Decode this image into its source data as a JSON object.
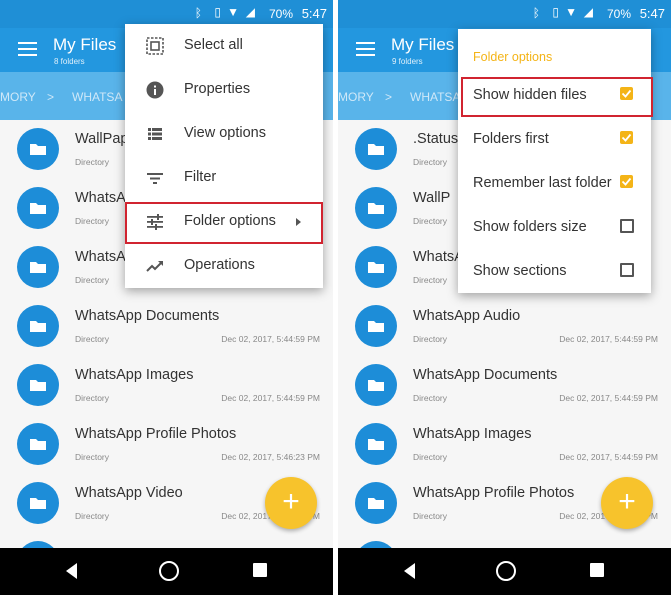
{
  "colors": {
    "primary": "#2397df",
    "status_bar": "#1f8fd6",
    "breadcrumb_bar": "#59b4ea",
    "folder_icon": "#1d8dd8",
    "accent": "#f4b417",
    "fab": "#f7c32c",
    "highlight": "#d12430"
  },
  "left": {
    "status": {
      "battery": "70%",
      "time": "5:47"
    },
    "appbar": {
      "title": "My Files",
      "subtitle": "8 folders",
      "menu_icon": "hamburger-icon"
    },
    "breadcrumbs": [
      "MORY",
      ">",
      "WHATSA"
    ],
    "files": [
      {
        "name": "WallPap",
        "type": "Directory",
        "date": ""
      },
      {
        "name": "WhatsA",
        "type": "Directory",
        "date": ""
      },
      {
        "name": "WhatsA",
        "type": "Directory",
        "date": ""
      },
      {
        "name": "WhatsApp Documents",
        "type": "Directory",
        "date": "Dec 02, 2017, 5:44:59 PM"
      },
      {
        "name": "WhatsApp Images",
        "type": "Directory",
        "date": "Dec 02, 2017, 5:44:59 PM"
      },
      {
        "name": "WhatsApp Profile Photos",
        "type": "Directory",
        "date": "Dec 02, 2017, 5:46:23 PM"
      },
      {
        "name": "WhatsApp Video",
        "type": "Directory",
        "date": "Dec 02, 2017, 5:44:59 PM"
      }
    ],
    "menu": [
      {
        "label": "Select all",
        "icon": "select-all-icon"
      },
      {
        "label": "Properties",
        "icon": "info-icon"
      },
      {
        "label": "View options",
        "icon": "list-view-icon"
      },
      {
        "label": "Filter",
        "icon": "filter-icon"
      },
      {
        "label": "Folder options",
        "icon": "tune-icon",
        "submenu": true,
        "highlighted": true
      },
      {
        "label": "Operations",
        "icon": "trending-icon"
      }
    ],
    "fab_label": "+"
  },
  "right": {
    "status": {
      "battery": "70%",
      "time": "5:47"
    },
    "appbar": {
      "title": "My Files",
      "subtitle": "9 folders",
      "menu_icon": "hamburger-icon"
    },
    "breadcrumbs": [
      "MORY",
      ">",
      "WHATSA"
    ],
    "files": [
      {
        "name": ".Status",
        "type": "Directory",
        "date": ""
      },
      {
        "name": "WallP",
        "type": "Directory",
        "date": ""
      },
      {
        "name": "WhatsA",
        "type": "Directory",
        "date": ""
      },
      {
        "name": "WhatsApp Audio",
        "type": "Directory",
        "date": "Dec 02, 2017, 5:44:59 PM"
      },
      {
        "name": "WhatsApp Documents",
        "type": "Directory",
        "date": "Dec 02, 2017, 5:44:59 PM"
      },
      {
        "name": "WhatsApp Images",
        "type": "Directory",
        "date": "Dec 02, 2017, 5:44:59 PM"
      },
      {
        "name": "WhatsApp Profile Photos",
        "type": "Directory",
        "date": "Dec 02, 2017, 5:46:23 PM"
      }
    ],
    "folder_options": {
      "header": "Folder options",
      "options": [
        {
          "label": "Show hidden files",
          "checked": true,
          "highlighted": true
        },
        {
          "label": "Folders first",
          "checked": true
        },
        {
          "label": "Remember last folder",
          "checked": true
        },
        {
          "label": "Show folders size",
          "checked": false
        },
        {
          "label": "Show sections",
          "checked": false
        }
      ]
    },
    "fab_label": "+"
  }
}
